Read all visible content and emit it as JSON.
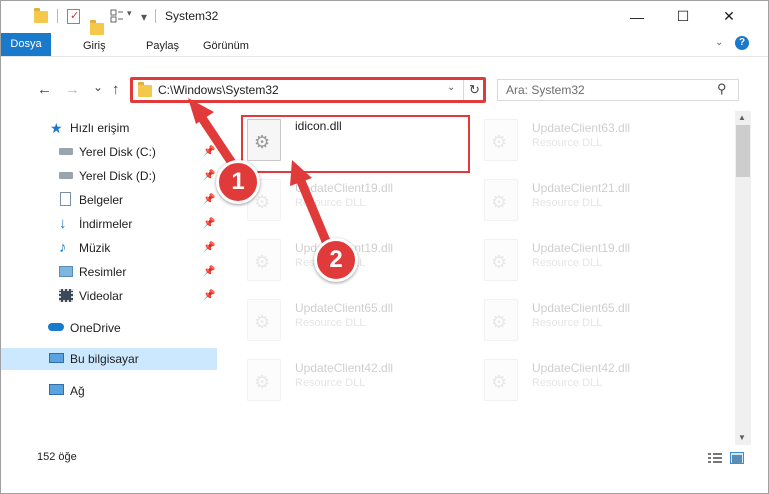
{
  "window": {
    "title": "System32",
    "controls": {
      "minimize": "—",
      "maximize": "☐",
      "close": "✕"
    }
  },
  "ribbon": {
    "tabs": [
      {
        "label": "Dosya"
      },
      {
        "label": "Giriş"
      },
      {
        "label": "Paylaş"
      },
      {
        "label": "Görünüm"
      }
    ],
    "help": "?"
  },
  "nav": {
    "back": "←",
    "forward": "→",
    "recent": "⌄",
    "up": "↑"
  },
  "address": {
    "path": "C:\\Windows\\System32",
    "dropdown": "⌄",
    "refresh": "↻"
  },
  "search": {
    "placeholder": "Ara: System32",
    "icon": "search-icon"
  },
  "sidebar": {
    "quick_access": "Hızlı erişim",
    "items": [
      {
        "label": "Yerel Disk (C:)",
        "icon": "drive-icon",
        "pinned": true
      },
      {
        "label": "Yerel Disk (D:)",
        "icon": "drive-icon",
        "pinned": true
      },
      {
        "label": "Belgeler",
        "icon": "documents-icon",
        "pinned": true
      },
      {
        "label": "İndirmeler",
        "icon": "downloads-icon",
        "pinned": true
      },
      {
        "label": "Müzik",
        "icon": "music-icon",
        "pinned": true
      },
      {
        "label": "Resimler",
        "icon": "pictures-icon",
        "pinned": true
      },
      {
        "label": "Videolar",
        "icon": "videos-icon",
        "pinned": true
      }
    ],
    "onedrive": "OneDrive",
    "this_pc": "Bu bilgisayar",
    "network": "Ağ"
  },
  "files": {
    "highlighted": {
      "name": "idicon.dll",
      "desc": ""
    },
    "faded": [
      {
        "name": "UpdateClient63.dll",
        "desc": "Resource DLL"
      },
      {
        "name": "UpdateClient19.dll",
        "desc": "Resource DLL"
      },
      {
        "name": "UpdateClient21.dll",
        "desc": "Resource DLL"
      },
      {
        "name": "UpdateClient19.dll",
        "desc": "Resource DLL"
      },
      {
        "name": "UpdateClient19.dll",
        "desc": "Resource DLL"
      },
      {
        "name": "UpdateClient65.dll",
        "desc": "Resource DLL"
      },
      {
        "name": "UpdateClient65.dll",
        "desc": "Resource DLL"
      },
      {
        "name": "UpdateClient42.dll",
        "desc": "Resource DLL"
      },
      {
        "name": "UpdateClient42.dll",
        "desc": "Resource DLL"
      }
    ]
  },
  "status": {
    "count": "152 öğe"
  },
  "annotations": {
    "step1": "1",
    "step2": "2",
    "color": "#e03a3a"
  },
  "colors": {
    "accent": "#1979ca",
    "selected": "#cce8ff"
  }
}
